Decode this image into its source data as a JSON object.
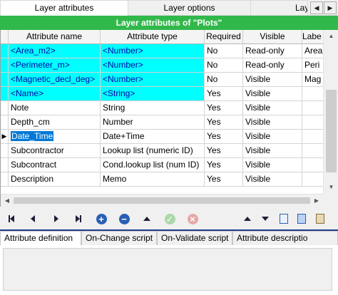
{
  "top_tabs": [
    "Layer attributes",
    "Layer options",
    "Lay"
  ],
  "banner": "Layer attributes of \"Plots\"",
  "columns": [
    "",
    "Attribute name",
    "Attribute type",
    "Required",
    "Visible",
    "Labe"
  ],
  "rows": [
    {
      "indicator": "",
      "name": "<Area_m2>",
      "type": "<Number>",
      "required": "No",
      "visible": "Read-only",
      "label": "Area"
    },
    {
      "indicator": "",
      "name": "<Perimeter_m>",
      "type": "<Number>",
      "required": "No",
      "visible": "Read-only",
      "label": "Peri"
    },
    {
      "indicator": "",
      "name": "<Magnetic_decl_deg>",
      "type": "<Number>",
      "required": "No",
      "visible": "Visible",
      "label": "Mag"
    },
    {
      "indicator": "",
      "name": "<Name>",
      "type": "<String>",
      "required": "Yes",
      "visible": "Visible",
      "label": ""
    },
    {
      "indicator": "",
      "name": "Note",
      "type": "String",
      "required": "Yes",
      "visible": "Visible",
      "label": ""
    },
    {
      "indicator": "",
      "name": "Depth_cm",
      "type": "Number",
      "required": "Yes",
      "visible": "Visible",
      "label": ""
    },
    {
      "indicator": "▶",
      "name": "Date_Time",
      "type": "Date+Time",
      "required": "Yes",
      "visible": "Visible",
      "label": ""
    },
    {
      "indicator": "",
      "name": "Subcontractor",
      "type": "Lookup list (numeric ID)",
      "required": "Yes",
      "visible": "Visible",
      "label": ""
    },
    {
      "indicator": "",
      "name": "Subcontract",
      "type": "Cond.lookup list (num ID)",
      "required": "Yes",
      "visible": "Visible",
      "label": ""
    },
    {
      "indicator": "",
      "name": "Description",
      "type": "Memo",
      "required": "Yes",
      "visible": "Visible",
      "label": ""
    }
  ],
  "bottom_tabs": [
    "Attribute definition",
    "On-Change script",
    "On-Validate script",
    "Attribute descriptio"
  ],
  "colors": {
    "banner": "#31b84a",
    "system_rows": "#00ffff",
    "selection": "#0078d7"
  },
  "toolbar_icons": [
    "first-record-icon",
    "prev-record-icon",
    "next-record-icon",
    "last-record-icon",
    "add-icon",
    "remove-icon",
    "up-arrow-icon",
    "confirm-icon",
    "cancel-icon",
    "move-up-icon",
    "move-down-icon",
    "import-icon",
    "copy-icon",
    "paste-icon"
  ]
}
